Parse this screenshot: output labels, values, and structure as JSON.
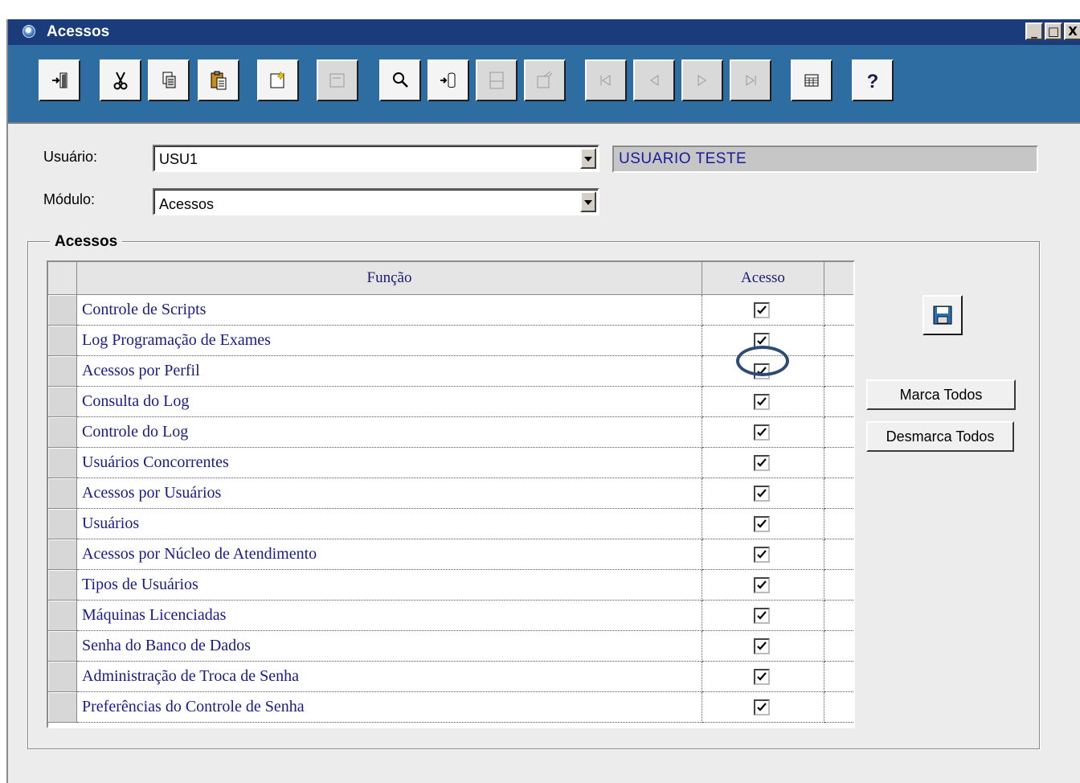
{
  "window": {
    "title": "Acessos",
    "controls": {
      "minimize": "_",
      "maximize": "□",
      "close": "X"
    }
  },
  "toolbar": {
    "buttons": [
      {
        "icon": "exit-icon",
        "enabled": true
      },
      {
        "icon": "cut-icon",
        "enabled": true
      },
      {
        "icon": "copy-icon",
        "enabled": true
      },
      {
        "icon": "paste-icon",
        "enabled": true
      },
      {
        "icon": "new-record-icon",
        "enabled": true
      },
      {
        "icon": "edit-record-icon",
        "enabled": false
      },
      {
        "icon": "search-icon",
        "enabled": true
      },
      {
        "icon": "insert-record-icon",
        "enabled": true
      },
      {
        "icon": "delete-record-icon",
        "enabled": false
      },
      {
        "icon": "cancel-record-icon",
        "enabled": false
      },
      {
        "icon": "first-record-icon",
        "enabled": false
      },
      {
        "icon": "previous-record-icon",
        "enabled": false
      },
      {
        "icon": "next-record-icon",
        "enabled": false
      },
      {
        "icon": "last-record-icon",
        "enabled": false
      },
      {
        "icon": "grid-view-icon",
        "enabled": true
      },
      {
        "icon": "help-icon",
        "enabled": true
      }
    ]
  },
  "form": {
    "usuario_label": "Usuário:",
    "usuario_value": "USU1",
    "usuario_nome": "USUARIO TESTE",
    "modulo_label": "Módulo:",
    "modulo_value": "Acessos"
  },
  "group": {
    "title": "Acessos",
    "columns": {
      "funcao": "Função",
      "acesso": "Acesso"
    },
    "rows": [
      {
        "funcao": "Controle de Scripts",
        "acesso": true
      },
      {
        "funcao": "Log Programação de Exames",
        "acesso": true
      },
      {
        "funcao": "Acessos por Perfil",
        "acesso": true
      },
      {
        "funcao": "Consulta do Log",
        "acesso": true
      },
      {
        "funcao": "Controle do Log",
        "acesso": true
      },
      {
        "funcao": "Usuários Concorrentes",
        "acesso": true
      },
      {
        "funcao": "Acessos por Usuários",
        "acesso": true
      },
      {
        "funcao": "Usuários",
        "acesso": true
      },
      {
        "funcao": "Acessos por Núcleo de Atendimento",
        "acesso": true
      },
      {
        "funcao": "Tipos de Usuários",
        "acesso": true
      },
      {
        "funcao": "Máquinas Licenciadas",
        "acesso": true
      },
      {
        "funcao": "Senha do Banco de Dados",
        "acesso": true
      },
      {
        "funcao": "Administração de Troca de Senha",
        "acesso": true
      },
      {
        "funcao": "Preferências do Controle de Senha",
        "acesso": true
      }
    ]
  },
  "actions": {
    "save_icon": "save-icon",
    "marca_todos": "Marca Todos",
    "desmarca_todos": "Desmarca Todos"
  },
  "colors": {
    "titlebar": "#1b3c7a",
    "toolbar": "#2d6da1",
    "grid_text": "#1a1a8a",
    "highlight_ring": "#2c4a74"
  }
}
